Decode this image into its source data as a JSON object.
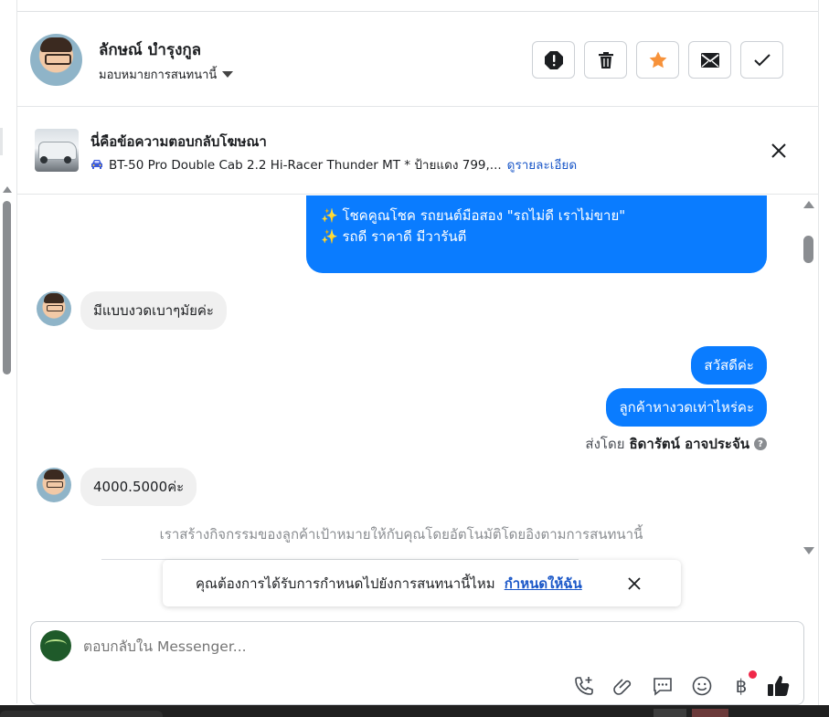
{
  "header": {
    "contact_name": "ลักษณ์ บำรุงกูล",
    "assign_label": "มอบหมายการสนทนานี้",
    "actions": [
      {
        "name": "report-button",
        "icon": "alert-icon"
      },
      {
        "name": "delete-button",
        "icon": "trash-icon"
      },
      {
        "name": "star-button",
        "icon": "star-icon"
      },
      {
        "name": "mark-unread-button",
        "icon": "envelope-icon"
      },
      {
        "name": "mark-done-button",
        "icon": "check-icon"
      }
    ]
  },
  "ad_banner": {
    "title": "นี่คือข้อความตอบกลับโฆษณา",
    "subtitle": "BT-50 Pro Double Cab 2.2 Hi-Racer Thunder MT * ป้ายแดง 799,...",
    "details_link": "ดูรายละเอียด"
  },
  "messages": {
    "outgoing_ad_line1": "✨ โชคคูณโชค รถยนต์มือสอง \"รถไม่ดี เราไม่ขาย\"",
    "outgoing_ad_line2": "✨ รถดี ราคาดี มีวารันตี",
    "incoming_1": "มีแบบงวดเบาๆมัยค่ะ",
    "outgoing_1": "สวัสดีค่ะ",
    "outgoing_2": "ลูกค้าหางวดเท่าไหร่คะ",
    "sent_by_prefix": "ส่งโดย",
    "sent_by_name": "ธิดารัตน์ อาจประจัน",
    "incoming_2": "4000.5000ค่ะ",
    "system_note": "เราสร้างกิจกรรมของลูกค้าเป้าหมายให้กับคุณโดยอัตโนมัติโดยอิงตามการสนทนานี้"
  },
  "assign_prompt": {
    "question": "คุณต้องการได้รับการกำหนดไปยังการสนทนานี้ไหม",
    "action": "กำหนดให้ฉัน"
  },
  "composer": {
    "placeholder": "ตอบกลับใน Messenger...",
    "currency_symbol": "฿"
  },
  "colors": {
    "outgoing_bubble": "#0a7cff",
    "incoming_bubble": "#f0f0f0",
    "link": "#1a57c8",
    "star": "#f7923a",
    "like": "#1c1e21"
  }
}
